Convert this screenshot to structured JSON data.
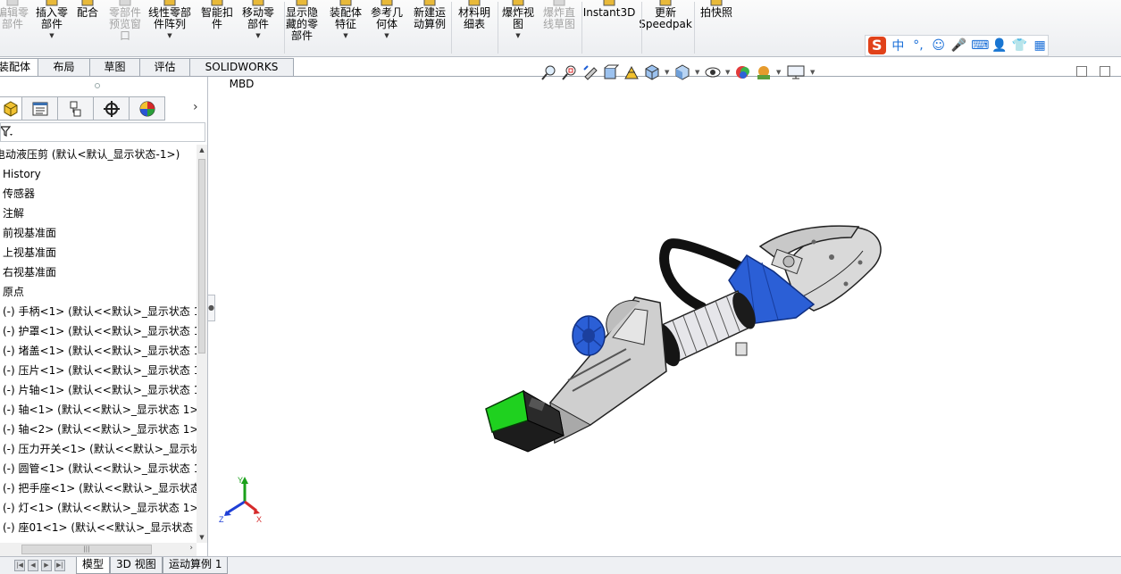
{
  "ribbon": {
    "buttons": [
      {
        "label": "编辑零\n部件",
        "disabled": true,
        "dropdown": false
      },
      {
        "label": "插入零\n部件",
        "disabled": false,
        "dropdown": true
      },
      {
        "label": "配合",
        "disabled": false,
        "dropdown": false
      },
      {
        "label": "零部件\n预览窗\n口",
        "disabled": true,
        "dropdown": false
      },
      {
        "label": "线性零部\n件阵列",
        "disabled": false,
        "dropdown": true
      },
      {
        "label": "智能扣\n件",
        "disabled": false,
        "dropdown": false
      },
      {
        "label": "移动零\n部件",
        "disabled": false,
        "dropdown": true
      },
      {
        "label": "显示隐\n藏的零\n部件",
        "disabled": false,
        "dropdown": false
      },
      {
        "label": "装配体\n特征",
        "disabled": false,
        "dropdown": true
      },
      {
        "label": "参考几\n何体",
        "disabled": false,
        "dropdown": true
      },
      {
        "label": "新建运\n动算例",
        "disabled": false,
        "dropdown": false
      },
      {
        "label": "材料明\n细表",
        "disabled": false,
        "dropdown": false
      },
      {
        "label": "爆炸视\n图",
        "disabled": false,
        "dropdown": true
      },
      {
        "label": "爆炸直\n线草图",
        "disabled": true,
        "dropdown": false
      },
      {
        "label": "Instant3D",
        "disabled": false,
        "dropdown": false
      },
      {
        "label": "更新\nSpeedpak",
        "disabled": false,
        "dropdown": false
      },
      {
        "label": "拍快照",
        "disabled": false,
        "dropdown": false
      }
    ]
  },
  "ime": {
    "logo": "S",
    "items": [
      "中",
      "°,",
      "☺",
      "🎤",
      "⌨",
      "👤",
      "👕",
      "▦"
    ]
  },
  "command_tabs": [
    "装配体",
    "布局",
    "草图",
    "评估",
    "SOLIDWORKS MBD"
  ],
  "feature_tree": {
    "filter_icon": "funnel-icon",
    "root": "电动液压剪 (默认<默认_显示状态-1>)",
    "items": [
      "History",
      "传感器",
      "注解",
      "前视基准面",
      "上视基准面",
      "右视基准面",
      "原点",
      "(-) 手柄<1> (默认<<默认>_显示状态 1",
      "(-) 护罩<1> (默认<<默认>_显示状态 1",
      "(-) 堵盖<1> (默认<<默认>_显示状态 1",
      "(-) 压片<1> (默认<<默认>_显示状态 1",
      "(-) 片轴<1> (默认<<默认>_显示状态 1",
      "(-) 轴<1> (默认<<默认>_显示状态 1>)",
      "(-) 轴<2> (默认<<默认>_显示状态 1>)",
      "(-) 压力开关<1> (默认<<默认>_显示状",
      "(-) 圆管<1> (默认<<默认>_显示状态 1",
      "(-) 把手座<1> (默认<<默认>_显示状态",
      "(-) 灯<1> (默认<<默认>_显示状态 1>)",
      "(-) 座01<1> (默认<<默认>_显示状态 1"
    ]
  },
  "bottom_tabs": [
    "模型",
    "3D 视图",
    "运动算例 1"
  ],
  "triad": {
    "x": "X",
    "y": "Y",
    "z": "Z"
  },
  "colors": {
    "accent_blue": "#1f5fd6",
    "battery_green": "#1fd11f",
    "body_grey": "#c9c9c9"
  }
}
